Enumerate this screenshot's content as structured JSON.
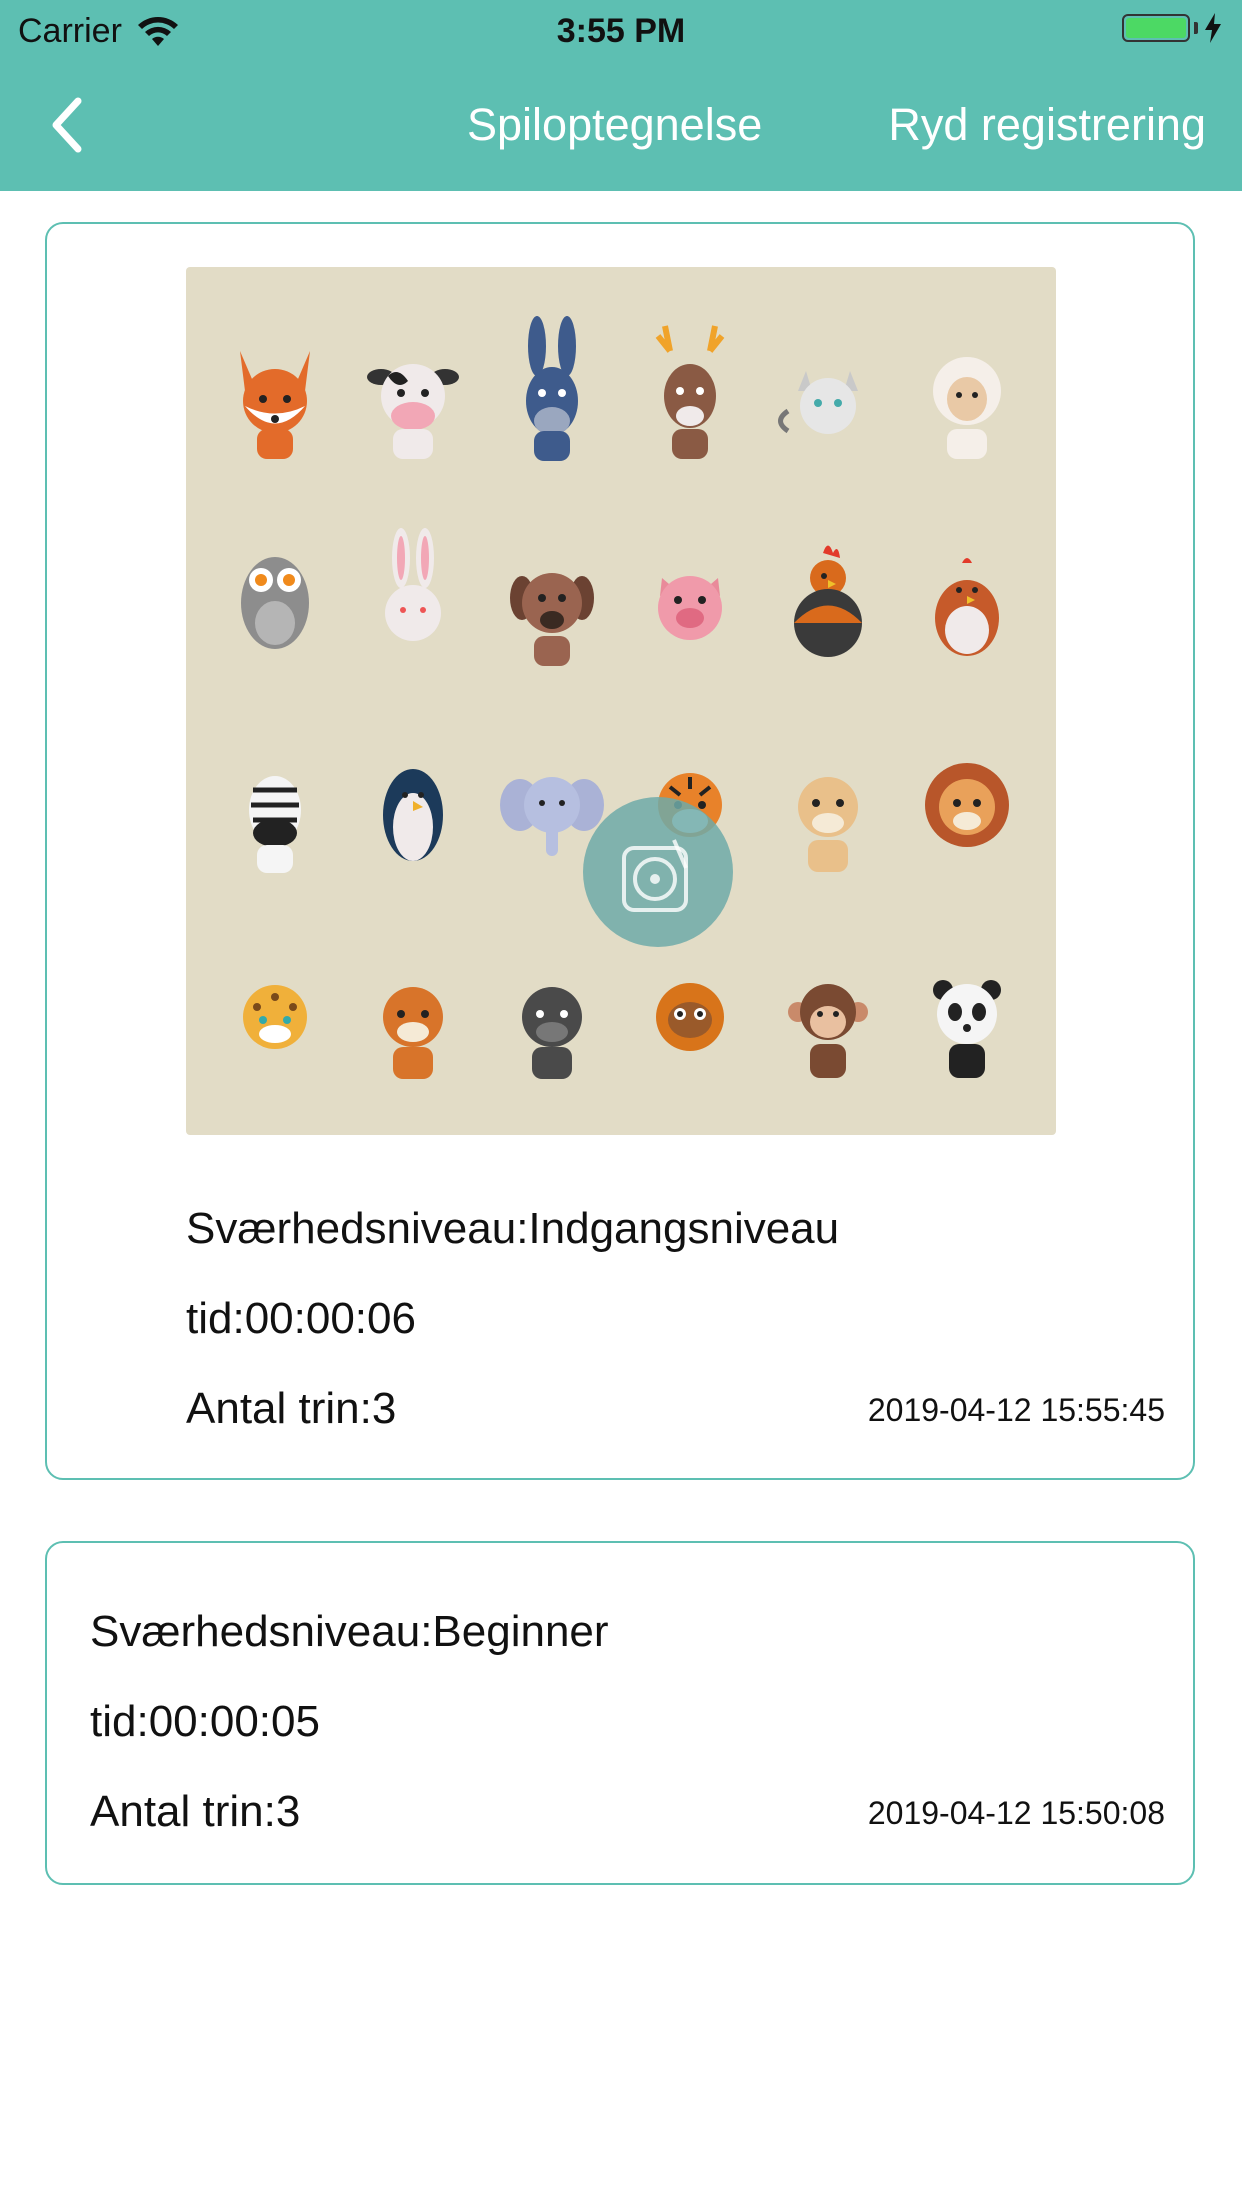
{
  "status_bar": {
    "carrier": "Carrier",
    "time": "3:55 PM",
    "battery_color": "#4cd964"
  },
  "nav": {
    "back_icon": "chevron-left-icon",
    "title": "Spiloptegnelse",
    "clear_label": "Ryd registrering",
    "color": "#5dbfb2"
  },
  "records": [
    {
      "has_image": true,
      "image_description_icon": "animal-puzzle-image",
      "difficulty": "Sværhedsniveau:Indgangsniveau",
      "time": "tid:00:00:06",
      "steps": "Antal trin:3",
      "date": "2019-04-12 15:55:45"
    },
    {
      "has_image": false,
      "difficulty": "Sværhedsniveau:Beginner",
      "time": "tid:00:00:05",
      "steps": "Antal trin:3",
      "date": "2019-04-12 15:50:08"
    }
  ]
}
